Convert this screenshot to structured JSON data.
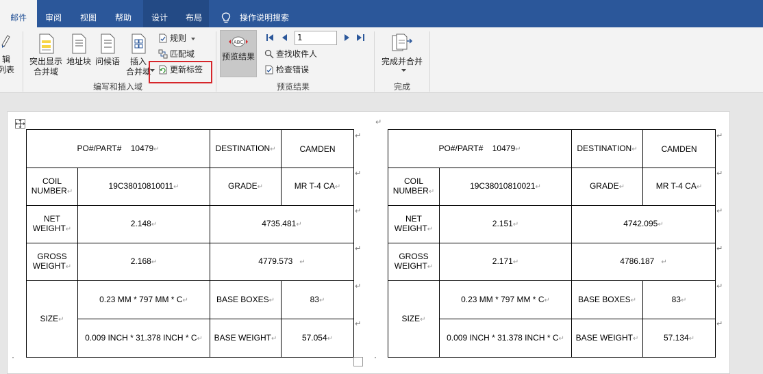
{
  "tabs": [
    {
      "id": "mail",
      "label": "邮件",
      "active": true
    },
    {
      "id": "review",
      "label": "审阅"
    },
    {
      "id": "view",
      "label": "视图"
    },
    {
      "id": "help",
      "label": "帮助"
    },
    {
      "id": "design",
      "label": "设计"
    },
    {
      "id": "layout",
      "label": "布局"
    }
  ],
  "tell_me": "操作说明搜索",
  "ribbon": {
    "partial_left": [
      "辑",
      "列表"
    ],
    "write_insert": {
      "label": "编写和插入域",
      "highlight_merge_fields": [
        "突出显示",
        "合并域"
      ],
      "address_block": "地址块",
      "greeting_line": "问候语",
      "insert_merge_field": [
        "插入",
        "合并域"
      ],
      "rules": "规则",
      "match_fields": "匹配域",
      "update_labels": "更新标签"
    },
    "preview": {
      "label": "预览结果",
      "preview_results": "预览结果",
      "record_number": "1",
      "find_recipient": "查找收件人",
      "check_errors": "检查错误"
    },
    "finish": {
      "label": "完成",
      "finish_merge": "完成并合并"
    }
  },
  "labels": [
    {
      "po_part": "PO#/PART#",
      "po_number": "10479",
      "destination_label": "DESTINATION",
      "destination": "CAMDEN",
      "coil_number_label": [
        "COIL",
        "NUMBER"
      ],
      "coil_number": "19C38010810011",
      "grade_label": "GRADE",
      "grade": "MR T-4 CA",
      "net_weight_label": [
        "NET",
        "WEIGHT"
      ],
      "net_weight_a": "2.148",
      "net_weight_b": "4735.481",
      "gross_weight_label": [
        "GROSS",
        "WEIGHT"
      ],
      "gross_weight_a": "2.168",
      "gross_weight_b": "4779.573",
      "size_label": "SIZE",
      "size_mm": "0.23 MM * 797 MM * C",
      "base_boxes_label": "BASE BOXES",
      "base_boxes": "83",
      "size_inch": "0.009 INCH * 31.378 INCH * C",
      "base_weight_label": "BASE WEIGHT",
      "base_weight": "57.054"
    },
    {
      "po_part": "PO#/PART#",
      "po_number": "10479",
      "destination_label": "DESTINATION",
      "destination": "CAMDEN",
      "coil_number_label": [
        "COIL",
        "NUMBER"
      ],
      "coil_number": "19C38010810021",
      "grade_label": "GRADE",
      "grade": "MR T-4 CA",
      "net_weight_label": [
        "NET",
        "WEIGHT"
      ],
      "net_weight_a": "2.151",
      "net_weight_b": "4742.095",
      "gross_weight_label": [
        "GROSS",
        "WEIGHT"
      ],
      "gross_weight_a": "2.171",
      "gross_weight_b": "4786.187",
      "size_label": "SIZE",
      "size_mm": "0.23 MM * 797 MM * C",
      "base_boxes_label": "BASE BOXES",
      "base_boxes": "83",
      "size_inch": "0.009 INCH * 31.378 INCH * C",
      "base_weight_label": "BASE WEIGHT",
      "base_weight": "57.134"
    }
  ],
  "marks": {
    "cell_end": "↵"
  },
  "colors": {
    "tab_bar": "#2b579a",
    "ribbon": "#f3f3f3",
    "highlight_box": "#d6262b",
    "canvas": "#e6e6e6"
  }
}
